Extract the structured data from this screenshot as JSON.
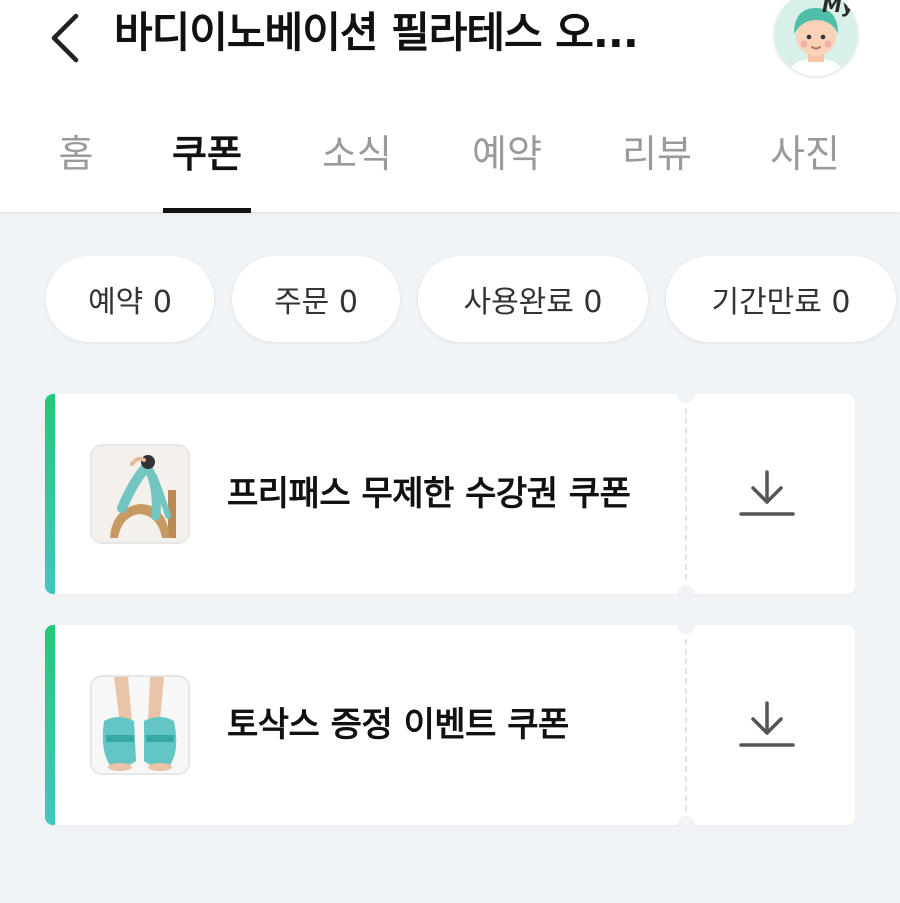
{
  "header": {
    "title": "바디이노베이션 필라테스 오...",
    "back_icon": "chevron-left-icon",
    "avatar_badge": "My"
  },
  "tabs": [
    {
      "label": "홈",
      "active": false
    },
    {
      "label": "쿠폰",
      "active": true
    },
    {
      "label": "소식",
      "active": false
    },
    {
      "label": "예약",
      "active": false
    },
    {
      "label": "리뷰",
      "active": false
    },
    {
      "label": "사진",
      "active": false
    }
  ],
  "filters": [
    {
      "label": "예약 0"
    },
    {
      "label": "주문 0"
    },
    {
      "label": "사용완료 0"
    },
    {
      "label": "기간만료 0"
    }
  ],
  "coupons": [
    {
      "title": "프리패스 무제한 수강권 쿠폰",
      "thumb": "pilates-pose-image",
      "action_icon": "download-icon"
    },
    {
      "title": "토삭스 증정 이벤트 쿠폰",
      "thumb": "toe-socks-image",
      "action_icon": "download-icon"
    }
  ],
  "colors": {
    "accent_start": "#21c978",
    "accent_end": "#3ec7c0",
    "background": "#f1f4f7",
    "text": "#111111",
    "muted": "#9a9a9a"
  }
}
